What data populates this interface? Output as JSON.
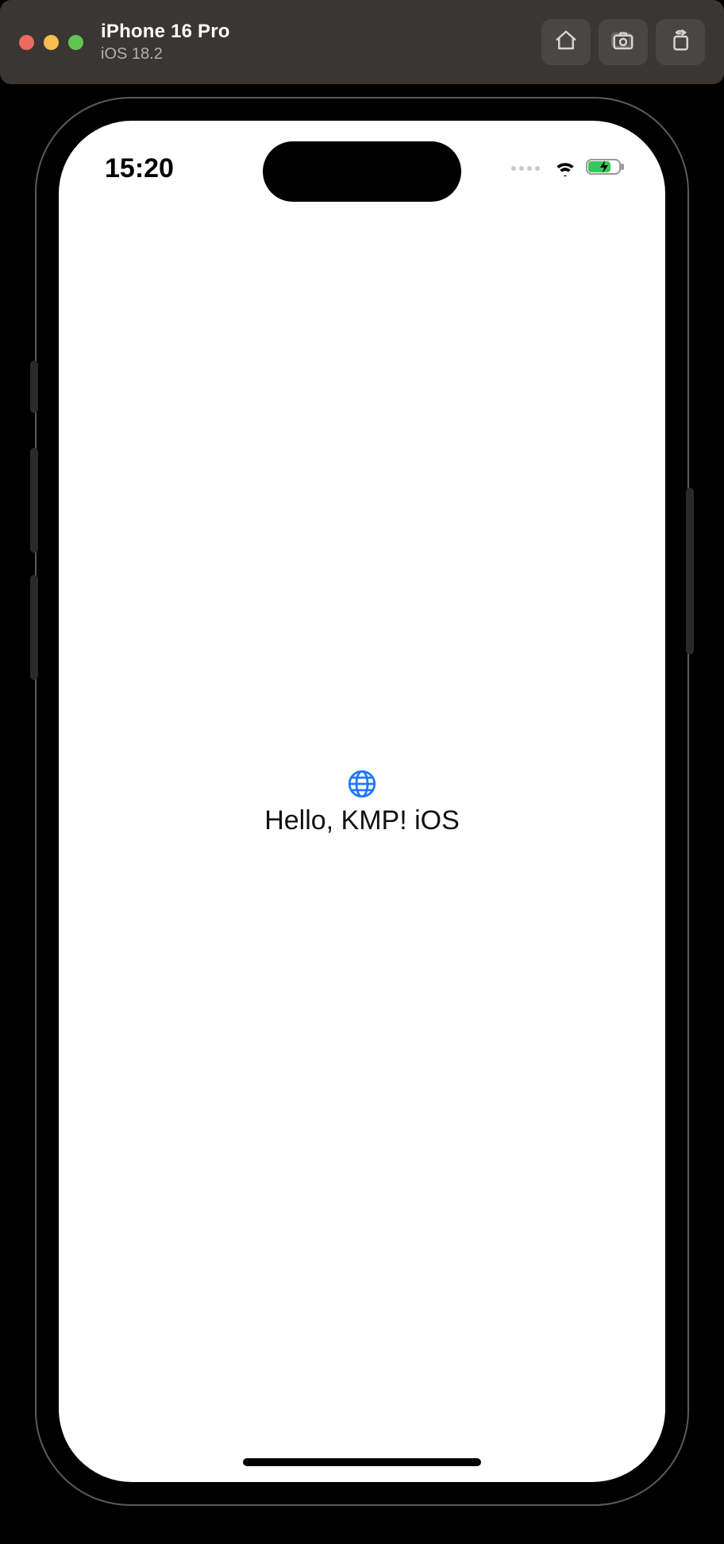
{
  "simulator": {
    "title": "iPhone 16 Pro",
    "subtitle": "iOS 18.2",
    "icons": {
      "home": "home-icon",
      "screenshot": "screenshot-icon",
      "rotate": "share-rotate-icon"
    }
  },
  "status": {
    "time": "15:20"
  },
  "app": {
    "greeting": "Hello, KMP! iOS",
    "icon_tint": "#1f77ff"
  }
}
